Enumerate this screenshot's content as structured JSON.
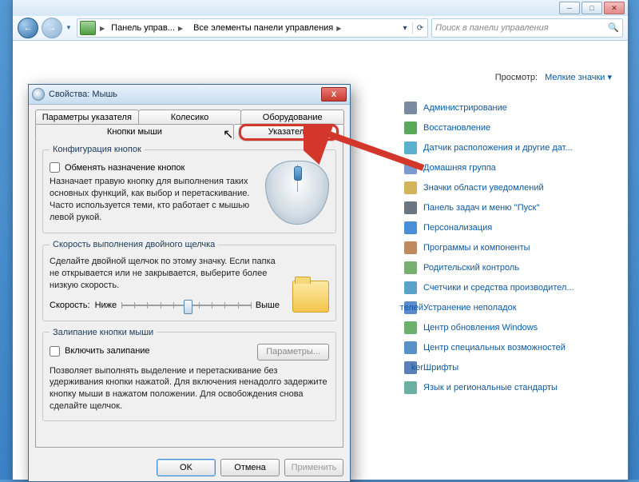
{
  "window": {
    "min": "─",
    "max": "□",
    "close": "✕"
  },
  "toolbar": {
    "back": "←",
    "fwd": "→",
    "breadcrumb": [
      "Панель управ...",
      "Все элементы панели управления"
    ],
    "refresh": "⟳",
    "search_placeholder": "Поиск в панели управления",
    "search_icon": "🔍"
  },
  "view": {
    "label": "Просмотр:",
    "mode": "Мелкие значки",
    "arrow": "▾"
  },
  "control_panel_items": [
    "Администрирование",
    "Восстановление",
    "Датчик расположения и другие дат...",
    "Домашняя группа",
    "Значки области уведомлений",
    "Панель задач и меню ''Пуск''",
    "Персонализация",
    "Программы и компоненты",
    "Родительский контроль",
    "Счетчики и средства производител...",
    "Устранение неполадок",
    "Центр обновления Windows",
    "Центр специальных возможностей",
    "Шрифты",
    "Язык и региональные стандарты"
  ],
  "partial_items": [
    "телей",
    "ker"
  ],
  "dialog": {
    "title": "Свойства: Мышь",
    "close": "X",
    "tabs_top": [
      "Параметры указателя",
      "Колесико",
      "Оборудование"
    ],
    "tabs_bottom": [
      "Кнопки мыши",
      "Указатели"
    ],
    "group1": {
      "legend": "Конфигурация кнопок",
      "checkbox": "Обменять назначение кнопок",
      "desc": "Назначает правую кнопку для выполнения таких основных функций, как выбор и перетаскивание. Часто используется теми, кто работает с мышью левой рукой."
    },
    "group2": {
      "legend": "Скорость выполнения двойного щелчка",
      "desc": "Сделайте двойной щелчок по этому значку. Если папка не открывается или не закрывается, выберите более низкую скорость.",
      "speed_label": "Скорость:",
      "low": "Ниже",
      "high": "Выше"
    },
    "group3": {
      "legend": "Залипание кнопки мыши",
      "checkbox": "Включить залипание",
      "params": "Параметры...",
      "desc": "Позволяет выполнять выделение и перетаскивание без удерживания кнопки нажатой. Для включения ненадолго задержите кнопку мыши в нажатом положении. Для освобождения снова сделайте щелчок."
    },
    "buttons": {
      "ok": "OK",
      "cancel": "Отмена",
      "apply": "Применить"
    }
  }
}
